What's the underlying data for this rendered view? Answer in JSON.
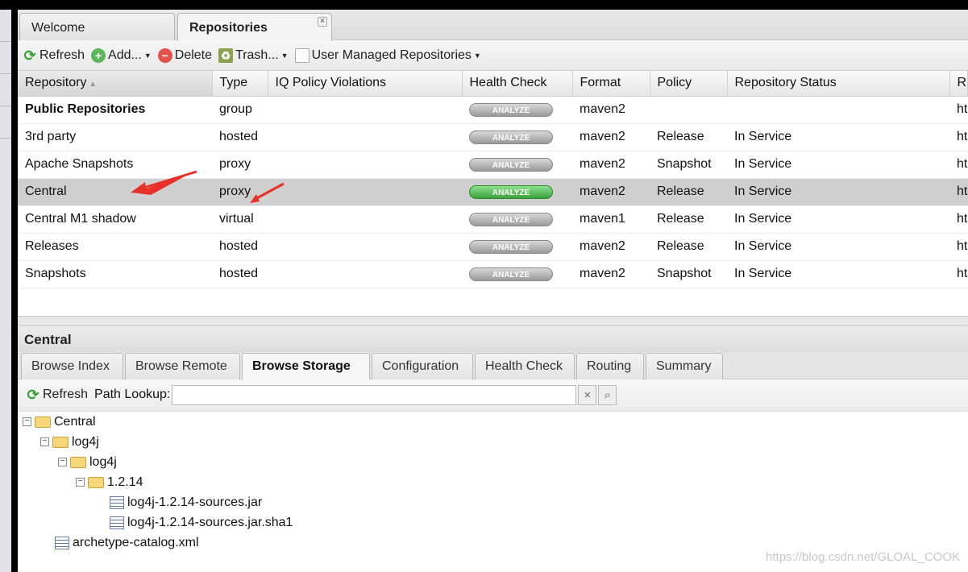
{
  "tabs": [
    {
      "label": "Welcome"
    },
    {
      "label": "Repositories"
    }
  ],
  "toolbar": {
    "refresh": "Refresh",
    "add": "Add...",
    "delete": "Delete",
    "trash": "Trash...",
    "user_managed": "User Managed Repositories"
  },
  "grid": {
    "columns": [
      "Repository",
      "Type",
      "IQ Policy Violations",
      "Health Check",
      "Format",
      "Policy",
      "Repository Status",
      "R"
    ],
    "analyze_label": "ANALYZE",
    "rows": [
      {
        "name": "Public Repositories",
        "type": "group",
        "format": "maven2",
        "policy": "",
        "status": "",
        "url": "ht",
        "bold": true
      },
      {
        "name": "3rd party",
        "type": "hosted",
        "format": "maven2",
        "policy": "Release",
        "status": "In Service",
        "url": "ht"
      },
      {
        "name": "Apache Snapshots",
        "type": "proxy",
        "format": "maven2",
        "policy": "Snapshot",
        "status": "In Service",
        "url": "ht"
      },
      {
        "name": "Central",
        "type": "proxy",
        "format": "maven2",
        "policy": "Release",
        "status": "In Service",
        "url": "ht",
        "selected": true
      },
      {
        "name": "Central M1 shadow",
        "type": "virtual",
        "format": "maven1",
        "policy": "Release",
        "status": "In Service",
        "url": "ht"
      },
      {
        "name": "Releases",
        "type": "hosted",
        "format": "maven2",
        "policy": "Release",
        "status": "In Service",
        "url": "ht"
      },
      {
        "name": "Snapshots",
        "type": "hosted",
        "format": "maven2",
        "policy": "Snapshot",
        "status": "In Service",
        "url": "ht"
      }
    ]
  },
  "detail": {
    "title": "Central",
    "tabs": [
      "Browse Index",
      "Browse Remote",
      "Browse Storage",
      "Configuration",
      "Health Check",
      "Routing",
      "Summary"
    ],
    "refresh": "Refresh",
    "path_lookup": "Path Lookup:",
    "path_value": "",
    "tree": [
      {
        "label": "Central",
        "type": "folder"
      },
      {
        "label": "log4j",
        "type": "folder"
      },
      {
        "label": "log4j",
        "type": "folder"
      },
      {
        "label": "1.2.14",
        "type": "folder"
      },
      {
        "label": "log4j-1.2.14-sources.jar",
        "type": "file"
      },
      {
        "label": "log4j-1.2.14-sources.jar.sha1",
        "type": "file"
      },
      {
        "label": "archetype-catalog.xml",
        "type": "file"
      }
    ]
  },
  "watermark": "https://blog.csdn.net/GLOAL_COOK",
  "colors": {
    "selected_row": "#cfcfcf",
    "analyze_active": "#3aa33a",
    "annotation_arrow": "#e8302a"
  }
}
